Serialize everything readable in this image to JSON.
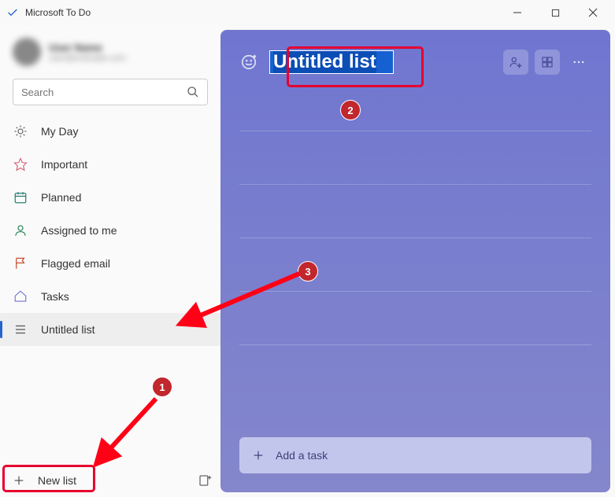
{
  "app": {
    "title": "Microsoft To Do"
  },
  "profile": {
    "name": "User Name",
    "email": "user@example.com"
  },
  "search": {
    "placeholder": "Search"
  },
  "sidebar": {
    "items": [
      {
        "label": "My Day"
      },
      {
        "label": "Important"
      },
      {
        "label": "Planned"
      },
      {
        "label": "Assigned to me"
      },
      {
        "label": "Flagged email"
      },
      {
        "label": "Tasks"
      },
      {
        "label": "Untitled list"
      }
    ],
    "new_list_label": "New list"
  },
  "main": {
    "title_value": "Untitled list",
    "add_task_label": "Add a task"
  },
  "annotations": {
    "b1": "1",
    "b2": "2",
    "b3": "3"
  }
}
